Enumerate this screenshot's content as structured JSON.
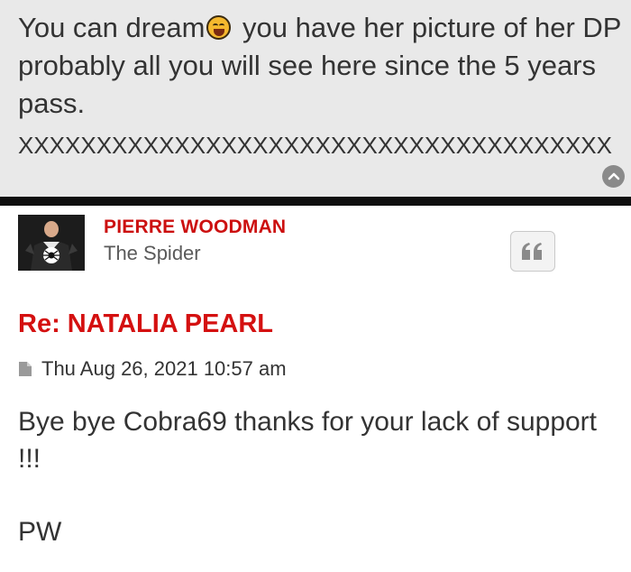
{
  "quote": {
    "text_before_emoji": "You can dream",
    "emoji": "laughing-face-emoji",
    "text_after_emoji": " you have her picture of her DP probably all you will see here since the 5 years pass.",
    "filler": "XXXXXXXXXXXXXXXXXXXXXXXXXXXXXXXXXXXXXX"
  },
  "post": {
    "author_name": "PIERRE WOODMAN",
    "author_rank": "The Spider",
    "title": "Re: NATALIA PEARL",
    "date": "Thu Aug 26, 2021 10:57 am",
    "body": "Bye bye Cobra69 thanks for your lack of support !!!",
    "signature": "PW"
  },
  "icons": {
    "scroll_top": "chevron-up-icon",
    "quote_button": "quote-icon",
    "post_meta": "document-icon"
  },
  "colors": {
    "accent_red": "#d41010",
    "quote_background": "#e9e9e9",
    "divider": "#0f0f0f",
    "text": "#333333"
  }
}
